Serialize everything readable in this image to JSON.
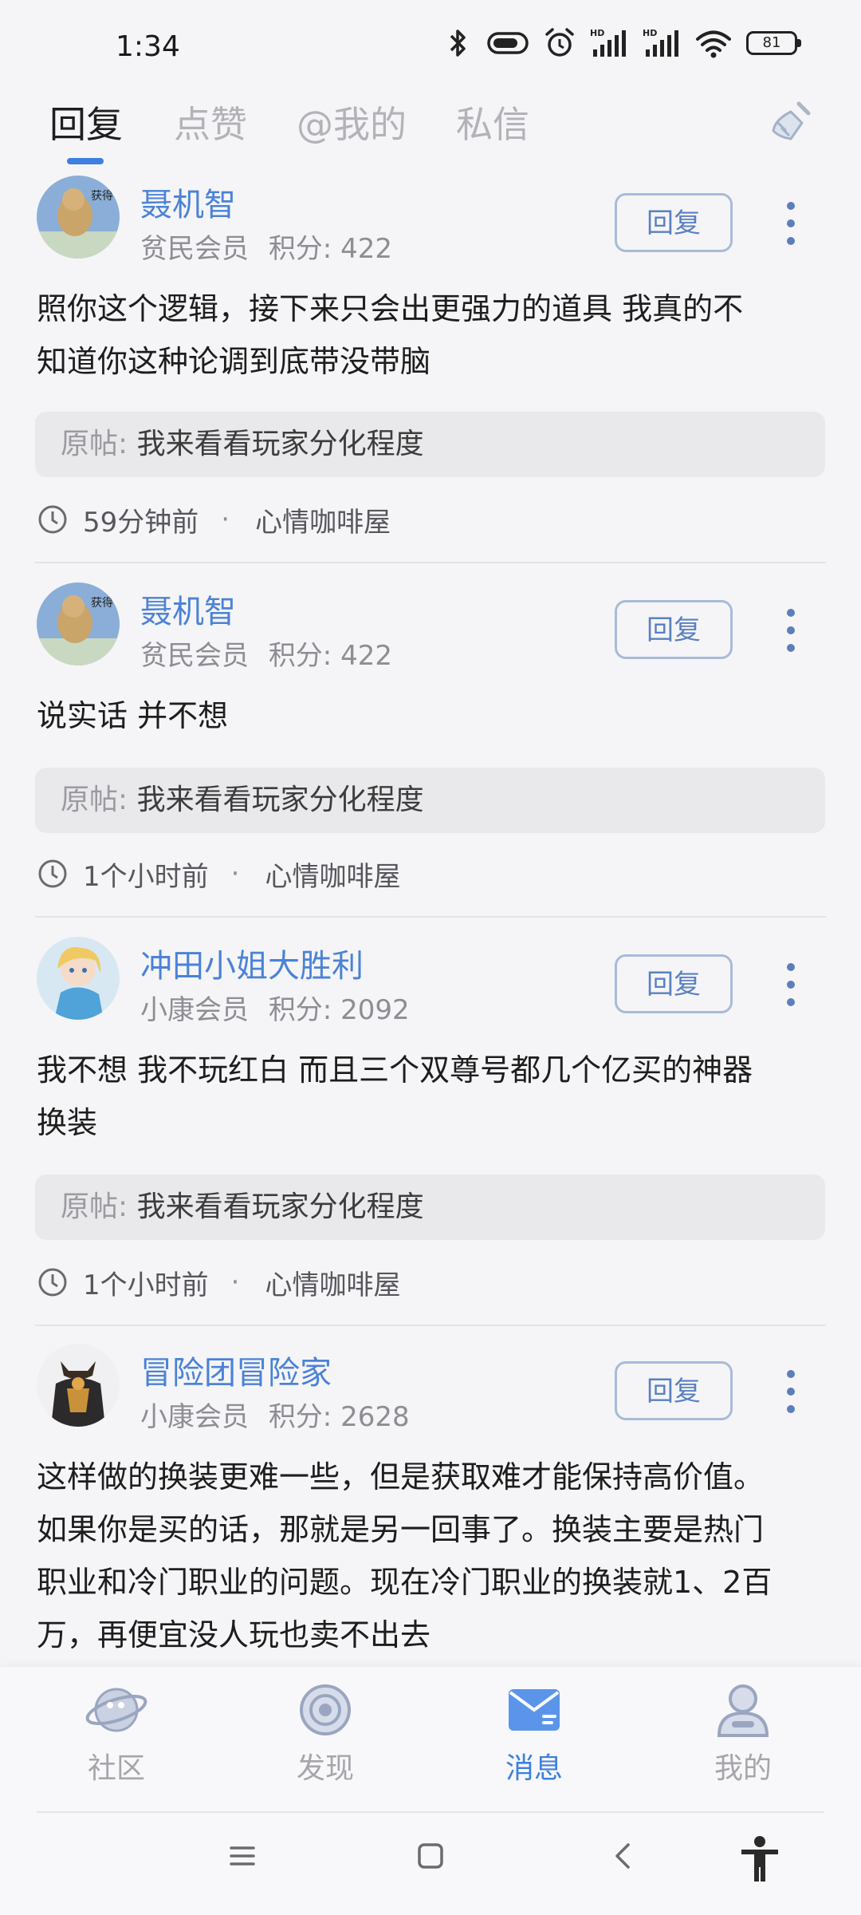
{
  "status_bar": {
    "time": "1:34",
    "battery": "81",
    "signal_labels": [
      "HD",
      "HD"
    ]
  },
  "tabs": [
    {
      "label": "回复",
      "active": true
    },
    {
      "label": "点赞",
      "active": false
    },
    {
      "label": "@我的",
      "active": false
    },
    {
      "label": "私信",
      "active": false
    }
  ],
  "posts": [
    {
      "username": "聂机智",
      "rank": "贫民会员",
      "points_label": "积分: 422",
      "reply_label": "回复",
      "content_lines": [
        "照你这个逻辑，接下来只会出更强力的道具 我真的不",
        "知道你这种论调到底带没带脑"
      ],
      "quote_prefix": "原帖: ",
      "quote_text": "我来看看玩家分化程度",
      "time": "59分钟前",
      "dot": "·",
      "forum": "心情咖啡屋"
    },
    {
      "username": "聂机智",
      "rank": "贫民会员",
      "points_label": "积分: 422",
      "reply_label": "回复",
      "content_lines": [
        "说实话 并不想"
      ],
      "quote_prefix": "原帖: ",
      "quote_text": "我来看看玩家分化程度",
      "time": "1个小时前",
      "dot": "·",
      "forum": "心情咖啡屋"
    },
    {
      "username": "冲田小姐大胜利",
      "rank": "小康会员",
      "points_label": "积分: 2092",
      "reply_label": "回复",
      "content_lines": [
        "我不想 我不玩红白 而且三个双尊号都几个亿买的神器",
        "换装"
      ],
      "quote_prefix": "原帖: ",
      "quote_text": "我来看看玩家分化程度",
      "time": "1个小时前",
      "dot": "·",
      "forum": "心情咖啡屋"
    },
    {
      "username": "冒险团冒险家",
      "rank": "小康会员",
      "points_label": "积分: 2628",
      "reply_label": "回复",
      "content_lines": [
        "这样做的换装更难一些，但是获取难才能保持高价值。",
        "如果你是买的话，那就是另一回事了。换装主要是热门",
        "职业和冷门职业的问题。现在冷门职业的换装就1、2百",
        "万，再便宜没人玩也卖不出去"
      ]
    }
  ],
  "avatar_badge": "获得",
  "bottom_nav": [
    {
      "label": "社区",
      "icon": "planet-icon",
      "active": false
    },
    {
      "label": "发现",
      "icon": "discover-icon",
      "active": false
    },
    {
      "label": "消息",
      "icon": "mail-icon",
      "active": true
    },
    {
      "label": "我的",
      "icon": "profile-icon",
      "active": false
    }
  ],
  "colors": {
    "accent": "#3d7fe0",
    "username": "#4b82d6",
    "background": "#f5f5f7"
  }
}
